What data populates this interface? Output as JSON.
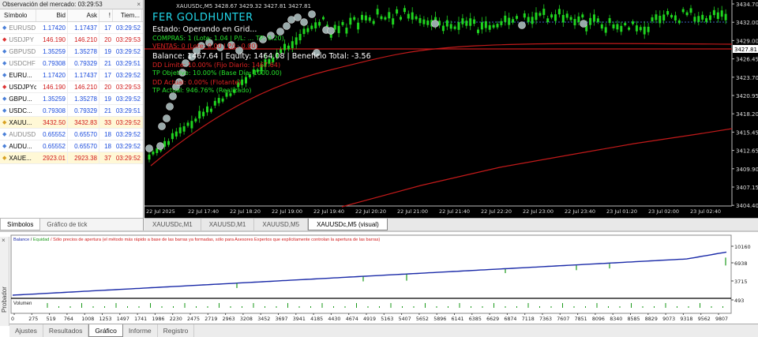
{
  "market_watch": {
    "title": "Observación del mercado: 03:29:53",
    "close": "×",
    "columns": [
      "Símbolo",
      "Bid",
      "Ask",
      "!",
      "Tiem..."
    ],
    "rows": [
      {
        "symbol": "EURUSD",
        "bid": "1.17420",
        "ask": "1.17437",
        "spread": "17",
        "time": "03:29:52",
        "dir": "up",
        "style": "grey"
      },
      {
        "symbol": "USDJPY",
        "bid": "146.190",
        "ask": "146.210",
        "spread": "20",
        "time": "03:29:53",
        "dir": "dn",
        "style": "grey"
      },
      {
        "symbol": "GBPUSD",
        "bid": "1.35259",
        "ask": "1.35278",
        "spread": "19",
        "time": "03:29:52",
        "dir": "up",
        "style": "grey"
      },
      {
        "symbol": "USDCHF",
        "bid": "0.79308",
        "ask": "0.79329",
        "spread": "21",
        "time": "03:29:51",
        "dir": "up",
        "style": "grey"
      },
      {
        "symbol": "EURU...",
        "bid": "1.17420",
        "ask": "1.17437",
        "spread": "17",
        "time": "03:29:52",
        "dir": "up",
        "style": ""
      },
      {
        "symbol": "USDJPYc",
        "bid": "146.190",
        "ask": "146.210",
        "spread": "20",
        "time": "03:29:53",
        "dir": "dn",
        "style": ""
      },
      {
        "symbol": "GBPU...",
        "bid": "1.35259",
        "ask": "1.35278",
        "spread": "19",
        "time": "03:29:52",
        "dir": "up",
        "style": ""
      },
      {
        "symbol": "USDC...",
        "bid": "0.79308",
        "ask": "0.79329",
        "spread": "21",
        "time": "03:29:51",
        "dir": "up",
        "style": ""
      },
      {
        "symbol": "XAUU...",
        "bid": "3432.50",
        "ask": "3432.83",
        "spread": "33",
        "time": "03:29:52",
        "dir": "hl",
        "style": "hl"
      },
      {
        "symbol": "AUDUSD",
        "bid": "0.65552",
        "ask": "0.65570",
        "spread": "18",
        "time": "03:29:52",
        "dir": "up",
        "style": "grey"
      },
      {
        "symbol": "AUDU...",
        "bid": "0.65552",
        "ask": "0.65570",
        "spread": "18",
        "time": "03:29:52",
        "dir": "up",
        "style": ""
      },
      {
        "symbol": "XAUE...",
        "bid": "2923.01",
        "ask": "2923.38",
        "spread": "37",
        "time": "03:29:52",
        "dir": "hl",
        "style": "hl"
      }
    ],
    "tabs": [
      "Símbolos",
      "Gráfico de tick"
    ]
  },
  "chart": {
    "symbol_line": "XAUUSDc,M5  3428.67 3429.32 3427.81 3427.81",
    "overlay": {
      "title": "FER GOLDHUNTER",
      "state": "Estado: Operando en Grid...",
      "buys": "COMPRAS: 1 (Lote: 1.04 | P/L: ...  TP: 0.20)",
      "sells": "VENTAS: 0 (Lote: 0.00 | P/L: 0.00)",
      "balance": "Balance: 1467.64 | Equity: 1464.08 | Beneficio Total: -3.56",
      "dd_limit": "DD Límite: 10.00% (Fijo Diario: 1467.64)",
      "tp_obj": "TP Objetivo: 10.00% (Base Día: 1000.00)",
      "dd_act": "DD Actual: 0.00% (Flotante)",
      "tp_act": "TP Actual: 946.76% (Realizado)"
    },
    "price_ticks": [
      "3434.70",
      "3432.00",
      "3429.00",
      "3426.45",
      "3423.70",
      "3420.95",
      "3418.20",
      "3415.45",
      "3412.65",
      "3409.90",
      "3407.15",
      "3404.40"
    ],
    "current_price": "3427.81",
    "time_labels": [
      "22 Jul 2025",
      "22 Jul 17:40",
      "22 Jul 18:20",
      "22 Jul 19:00",
      "22 Jul 19:40",
      "22 Jul 20:20",
      "22 Jul 21:00",
      "22 Jul 21:40",
      "22 Jul 22:20",
      "22 Jul 23:00",
      "22 Jul 23:40",
      "23 Jul 01:20",
      "23 Jul 02:00",
      "23 Jul 02:40"
    ]
  },
  "chart_tabs": [
    "XAUUSDc,M1",
    "XAUUSD,M1",
    "XAUUSD,M5",
    "XAUUSDc,M5 (visual)"
  ],
  "tester": {
    "side_label": "Probador",
    "side_close": "×",
    "legend_balance": "Balance",
    "legend_sep": " / ",
    "legend_equity": "Equidad",
    "legend_note": " / Sólo precios de apertura (el método más rápido a base de las barras ya formadas, sólo para Asesores Expertos que explícitamente controlan la apertura de las barras)",
    "y_ticks": [
      "10160",
      "6938",
      "3715",
      "493"
    ],
    "volume_label": "Volumen",
    "x_ticks": [
      "0",
      "275",
      "519",
      "764",
      "1008",
      "1253",
      "1497",
      "1741",
      "1986",
      "2230",
      "2475",
      "2719",
      "2963",
      "3208",
      "3452",
      "3697",
      "3941",
      "4185",
      "4430",
      "4674",
      "4919",
      "5163",
      "5407",
      "5652",
      "5896",
      "6141",
      "6385",
      "6629",
      "6874",
      "7118",
      "7363",
      "7607",
      "7851",
      "8096",
      "8340",
      "8585",
      "8829",
      "9073",
      "9318",
      "9562",
      "9807"
    ],
    "tabs": [
      "Ajustes",
      "Resultados",
      "Gráfico",
      "Informe",
      "Registro"
    ],
    "active_tab": "Gráfico"
  },
  "colors": {
    "chart_bg": "#000000",
    "candle": "#1fd41f",
    "ma": "#c21a1a",
    "title": "#22d6e8",
    "balance": "#1a2aa8",
    "equity": "#1a9a1a"
  }
}
